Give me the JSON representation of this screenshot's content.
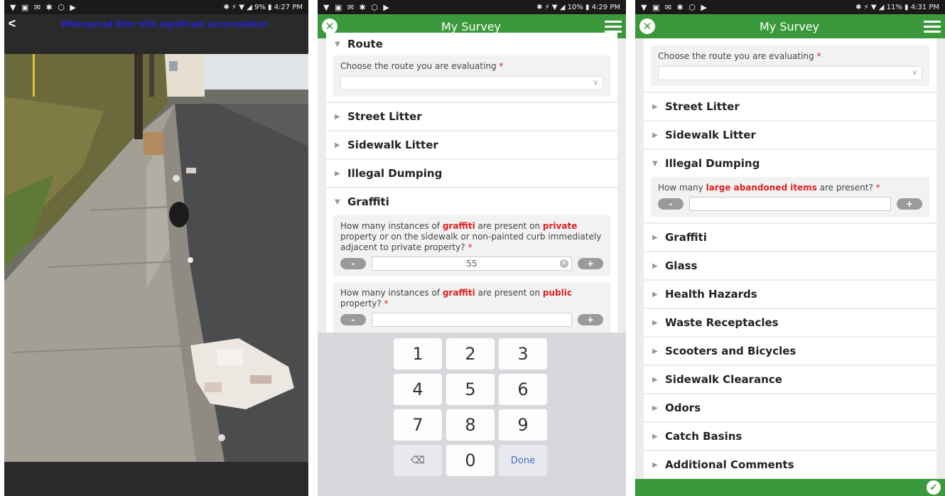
{
  "panel1": {
    "status_left": "▼ ▣ ✉ ✱ ⬡ ▶",
    "status_right": "✱ ⚡ ▼ ◢ 9% ▮ 4:27 PM",
    "title": "Widespread litter with significant accumulation"
  },
  "panel2": {
    "status_left": "▼ ▣ ✉ ✱ ⬡ ▶",
    "status_right": "✱ ⚡ ▼ ◢ 10% ▮ 4:29 PM",
    "app_title": "My Survey",
    "route_label": "Route",
    "route_question": "Choose the route you are evaluating",
    "required": "*",
    "sections": [
      "Street Litter",
      "Sidewalk Litter",
      "Illegal Dumping"
    ],
    "graffiti_label": "Graffiti",
    "q1_a": "How many instances of ",
    "q1_hl1": "graffiti",
    "q1_b": " are present on ",
    "q1_hl2": "private",
    "q1_c": " property or on the sidewalk or non-painted curb immediately adjacent to private property?",
    "q1_value": "55",
    "q2_a": "How many instances of ",
    "q2_hl1": "graffiti",
    "q2_b": " are present on ",
    "q2_hl2": "public",
    "q2_c": " property?",
    "minus": "-",
    "plus": "+",
    "keys": [
      "1",
      "2",
      "3",
      "4",
      "5",
      "6",
      "7",
      "8",
      "9",
      "⌫",
      "0",
      "Done"
    ]
  },
  "panel3": {
    "status_left": "▼ ▣ ✉ ✱ ⬡ ▶",
    "status_right": "✱ ⚡ ▼ ◢ 11% ▮ 4:31 PM",
    "app_title": "My Survey",
    "route_question": "Choose the route you are evaluating",
    "required": "*",
    "sections_top": [
      "Street Litter",
      "Sidewalk Litter"
    ],
    "dumping_label": "Illegal Dumping",
    "dq_a": "How many ",
    "dq_hl": "large abandoned items",
    "dq_b": " are present?",
    "minus": "-",
    "plus": "+",
    "sections_bottom": [
      "Graffiti",
      "Glass",
      "Health Hazards",
      "Waste Receptacles",
      "Scooters and Bicycles",
      "Sidewalk Clearance",
      "Odors",
      "Catch Basins",
      "Additional Comments"
    ]
  },
  "colors": {
    "green": "#3a9a3b",
    "required_red": "#e02020",
    "title_blue": "#2323d8"
  }
}
